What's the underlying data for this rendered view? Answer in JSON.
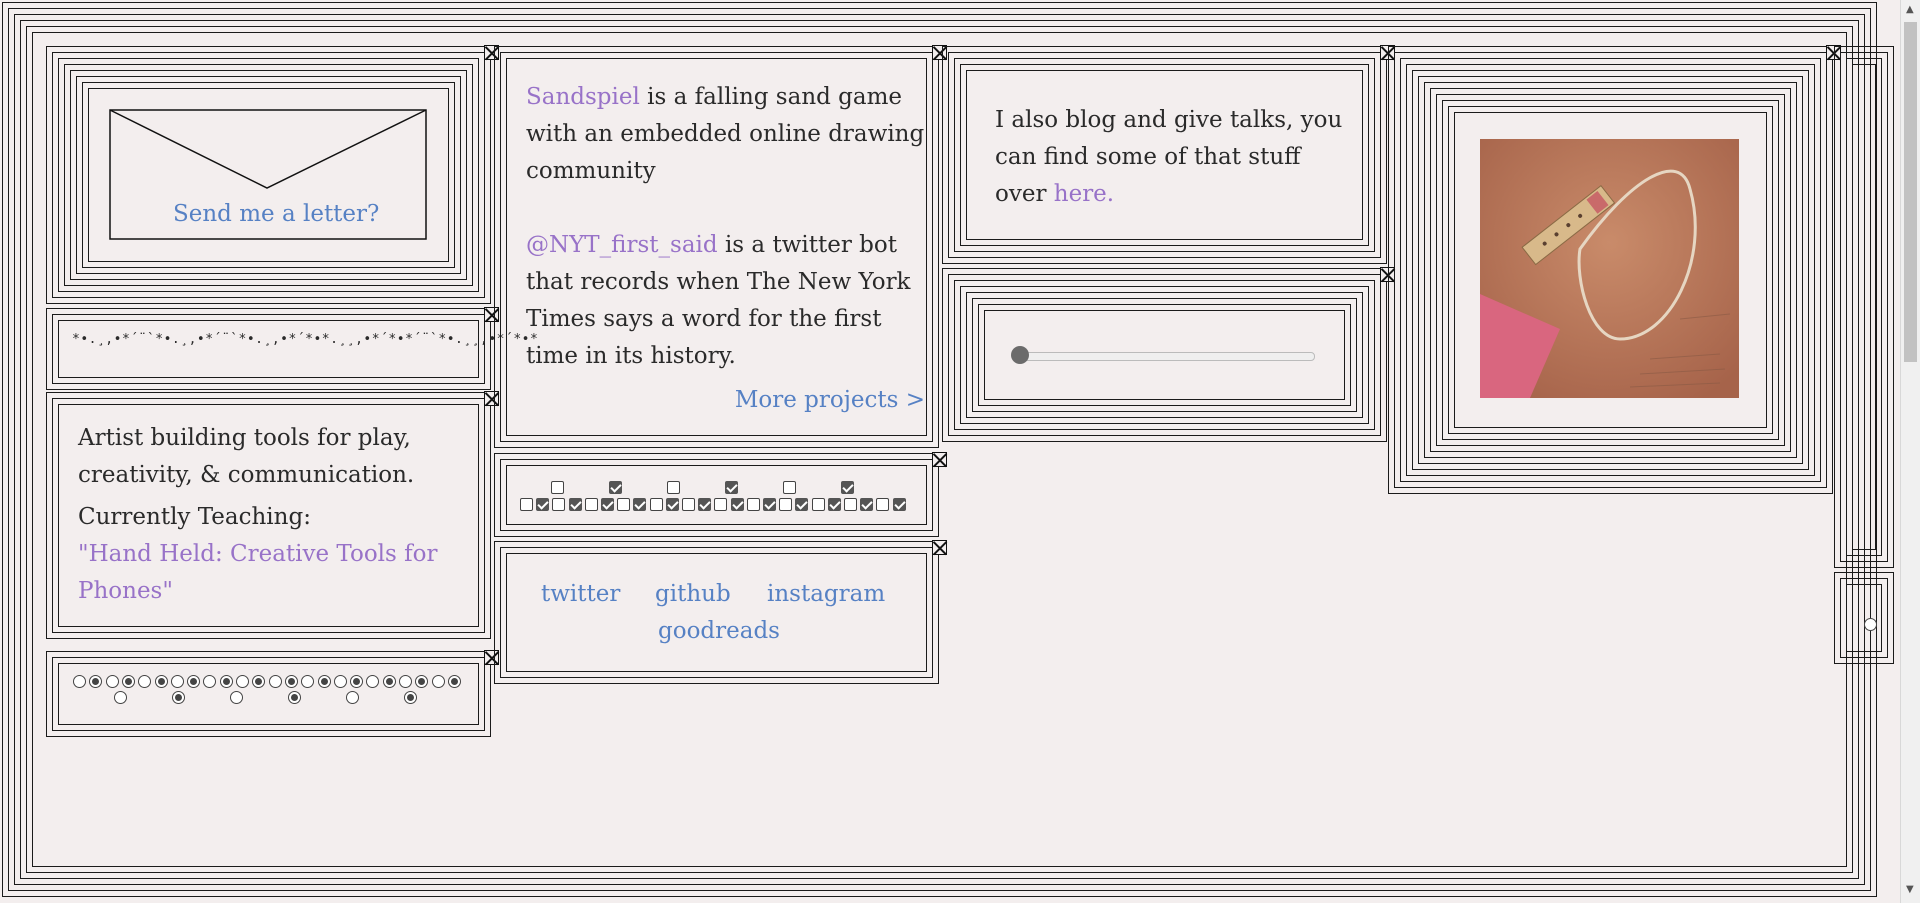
{
  "letter": {
    "link": "Send me a letter?"
  },
  "sparkle": {
    "text": "*•.¸,•*´¨`*•.¸,•*´¨`*•.¸,•*´*•*.¸¸,•*´*•*´¨`*•.¸¸,•*´*•*"
  },
  "bio": {
    "line1": "Artist building tools for play,",
    "line2": "creativity, & communication.",
    "teaching_label": "Currently Teaching:",
    "course_line1": "\"Hand Held: Creative Tools for",
    "course_line2": "Phones\""
  },
  "projects": {
    "sandspiel_link": "Sandspiel",
    "sandspiel_l1": " is a falling sand game",
    "sandspiel_l2": "with an embedded online drawing",
    "sandspiel_l3": "community",
    "nyt_link": "@NYT_first_said",
    "nyt_l1": " is a twitter bot",
    "nyt_l2": "that records when The New York",
    "nyt_l3": "Times says a word for the first",
    "nyt_l4": "time in its history.",
    "more": "More projects >"
  },
  "social": {
    "links": [
      "twitter",
      "github",
      "instagram",
      "goodreads"
    ]
  },
  "blog": {
    "l1": "I also blog and give talks, you",
    "l2": "can find some of that stuff",
    "l3_prefix": "over ",
    "here": "here."
  },
  "slider": {
    "value": 0
  },
  "photo": {
    "alt": "power strip on brown paper"
  },
  "checkbox_grid": {
    "top_row": [
      false,
      true,
      false,
      true,
      false,
      true
    ],
    "bottom_row": [
      false,
      true,
      false,
      true,
      false,
      true,
      false,
      true,
      false,
      true,
      false,
      true,
      false,
      true,
      false,
      true,
      false,
      true,
      false,
      true,
      false,
      true,
      false,
      true
    ]
  },
  "radio_grid": {
    "top_row": [
      false,
      true,
      false,
      true,
      false,
      true,
      false,
      true,
      false,
      true,
      false,
      true,
      false,
      true,
      false,
      true,
      false,
      true,
      false,
      true,
      false,
      true,
      false,
      true
    ],
    "bottom_row": [
      false,
      true,
      false,
      true,
      false,
      true
    ]
  },
  "colors": {
    "purple": "#9872c8",
    "blue": "#5681c4",
    "bg": "#f3eeee"
  }
}
